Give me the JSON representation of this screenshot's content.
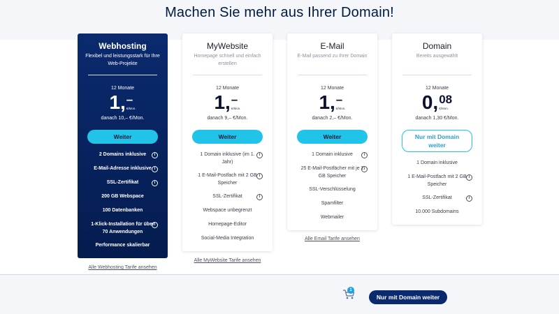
{
  "page": {
    "title": "Machen Sie mehr aus Ihrer Domain!"
  },
  "colors": {
    "accent": "#21c4e8",
    "dark": "#0b2a6e",
    "background": "#f4f6fa"
  },
  "cards": [
    {
      "title": "Webhosting",
      "subtitle": "Flexibel und leistungsstark für Ihre Web-Projekte",
      "term": "12 Monate",
      "price_main": "1,",
      "price_cents": "–",
      "price_unit": "€/Mon.",
      "after": "danach 10,– €/Mon.",
      "button": "Weiter",
      "features": [
        {
          "text": "2 Domains inklusive",
          "info": true
        },
        {
          "text": "E-Mail-Adresse inklusive",
          "info": true
        },
        {
          "text": "SSL-Zertifikat",
          "info": true
        },
        {
          "text": "200 GB Webspace",
          "info": false
        },
        {
          "text": "100 Datenbanken",
          "info": false
        },
        {
          "text": "1-Klick-Installation für über 70 Anwendungen",
          "info": true
        },
        {
          "text": "Performance skalierbar",
          "info": false
        }
      ],
      "link": "Alle Webhosting Tarife ansehen"
    },
    {
      "title": "MyWebsite",
      "subtitle": "Homepage schnell und einfach erstellen",
      "term": "12 Monate",
      "price_main": "1,",
      "price_cents": "–",
      "price_unit": "€/Mon.",
      "after": "danach 9,– €/Mon.",
      "button": "Weiter",
      "features": [
        {
          "text": "1 Domain inklusive (im 1. Jahr)",
          "info": true
        },
        {
          "text": "1 E-Mail-Postfach mit 2 GB Speicher",
          "info": true
        },
        {
          "text": "SSL-Zertifikat",
          "info": true
        },
        {
          "text": "Webspace unbegrenzt",
          "info": false
        },
        {
          "text": "Homepage-Editor",
          "info": false
        },
        {
          "text": "Social-Media Integration",
          "info": false
        }
      ],
      "link": "Alle MyWebsite Tarife ansehen"
    },
    {
      "title": "E-Mail",
      "subtitle": "E-Mail passend zu Ihrer Domain",
      "term": "12 Monate",
      "price_main": "1,",
      "price_cents": "–",
      "price_unit": "€/Mon.",
      "after": "danach 2,– €/Mon.",
      "button": "Weiter",
      "features": [
        {
          "text": "1 Domain inklusive",
          "info": true
        },
        {
          "text": "25 E-Mail-Postfächer mit je 2 GB Speicher",
          "info": true
        },
        {
          "text": "SSL-Verschlüsselung",
          "info": false
        },
        {
          "text": "Spamfilter",
          "info": false
        },
        {
          "text": "Webmailer",
          "info": false
        }
      ],
      "link": "Alle Email Tarife ansehen"
    },
    {
      "title": "Domain",
      "subtitle": "Bereits ausgewählt",
      "term": "12 Monate",
      "price_main": "0,",
      "price_cents": "08",
      "price_unit": "€/Mon.",
      "after": "danach 1,30 €/Mon.",
      "button": "Nur mit Domain weiter",
      "features": [
        {
          "text": "1 Domain inklusive",
          "info": false
        },
        {
          "text": "1 E-Mail-Postfach mit 2 GB Speicher",
          "info": true
        },
        {
          "text": "SSL-Zertifikat",
          "info": true
        },
        {
          "text": "10.000 Subdomains",
          "info": false
        }
      ],
      "link": ""
    }
  ],
  "bottom": {
    "cart_count": "1",
    "cart_icon": "shopping-cart-icon",
    "button": "Nur mit Domain weiter"
  }
}
